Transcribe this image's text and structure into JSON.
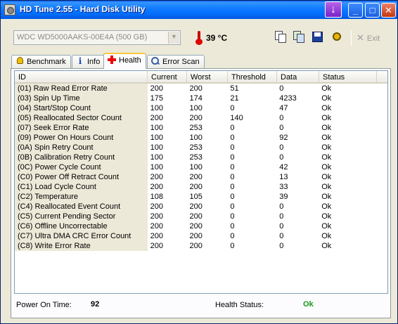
{
  "window": {
    "title": "HD Tune 2.55 - Hard Disk Utility",
    "minimize_glyph": "_",
    "maximize_glyph": "□",
    "close_glyph": "✕",
    "download_glyph": "↓"
  },
  "toolbar": {
    "drive": "WDC WD5000AAKS-00E4A (500 GB)",
    "temperature": "39 °C",
    "icons": [
      "copy-text-icon",
      "copy-screenshot-icon",
      "save-icon",
      "options-icon"
    ],
    "exit_label": "Exit"
  },
  "tabs": [
    {
      "label": "Benchmark",
      "icon": "benchmark-icon",
      "active": false
    },
    {
      "label": "Info",
      "icon": "info-icon",
      "active": false
    },
    {
      "label": "Health",
      "icon": "health-icon",
      "active": true
    },
    {
      "label": "Error Scan",
      "icon": "error-scan-icon",
      "active": false
    }
  ],
  "table": {
    "columns": [
      "ID",
      "Current",
      "Worst",
      "Threshold",
      "Data",
      "Status"
    ],
    "rows": [
      [
        "(01) Raw Read Error Rate",
        "200",
        "200",
        "51",
        "0",
        "Ok"
      ],
      [
        "(03) Spin Up Time",
        "175",
        "174",
        "21",
        "4233",
        "Ok"
      ],
      [
        "(04) Start/Stop Count",
        "100",
        "100",
        "0",
        "47",
        "Ok"
      ],
      [
        "(05) Reallocated Sector Count",
        "200",
        "200",
        "140",
        "0",
        "Ok"
      ],
      [
        "(07) Seek Error Rate",
        "100",
        "253",
        "0",
        "0",
        "Ok"
      ],
      [
        "(09) Power On Hours Count",
        "100",
        "100",
        "0",
        "92",
        "Ok"
      ],
      [
        "(0A) Spin Retry Count",
        "100",
        "253",
        "0",
        "0",
        "Ok"
      ],
      [
        "(0B) Calibration Retry Count",
        "100",
        "253",
        "0",
        "0",
        "Ok"
      ],
      [
        "(0C) Power Cycle Count",
        "100",
        "100",
        "0",
        "42",
        "Ok"
      ],
      [
        "(C0) Power Off Retract Count",
        "200",
        "200",
        "0",
        "13",
        "Ok"
      ],
      [
        "(C1) Load Cycle Count",
        "200",
        "200",
        "0",
        "33",
        "Ok"
      ],
      [
        "(C2) Temperature",
        "108",
        "105",
        "0",
        "39",
        "Ok"
      ],
      [
        "(C4) Reallocated Event Count",
        "200",
        "200",
        "0",
        "0",
        "Ok"
      ],
      [
        "(C5) Current Pending Sector",
        "200",
        "200",
        "0",
        "0",
        "Ok"
      ],
      [
        "(C6) Offline Uncorrectable",
        "200",
        "200",
        "0",
        "0",
        "Ok"
      ],
      [
        "(C7) Ultra DMA CRC Error Count",
        "200",
        "200",
        "0",
        "0",
        "Ok"
      ],
      [
        "(C8) Write Error Rate",
        "200",
        "200",
        "0",
        "0",
        "Ok"
      ]
    ]
  },
  "footer": {
    "power_on_label": "Power On Time:",
    "power_on_value": "92",
    "health_label": "Health Status:",
    "health_value": "Ok",
    "health_color": "#1a9a1a"
  }
}
